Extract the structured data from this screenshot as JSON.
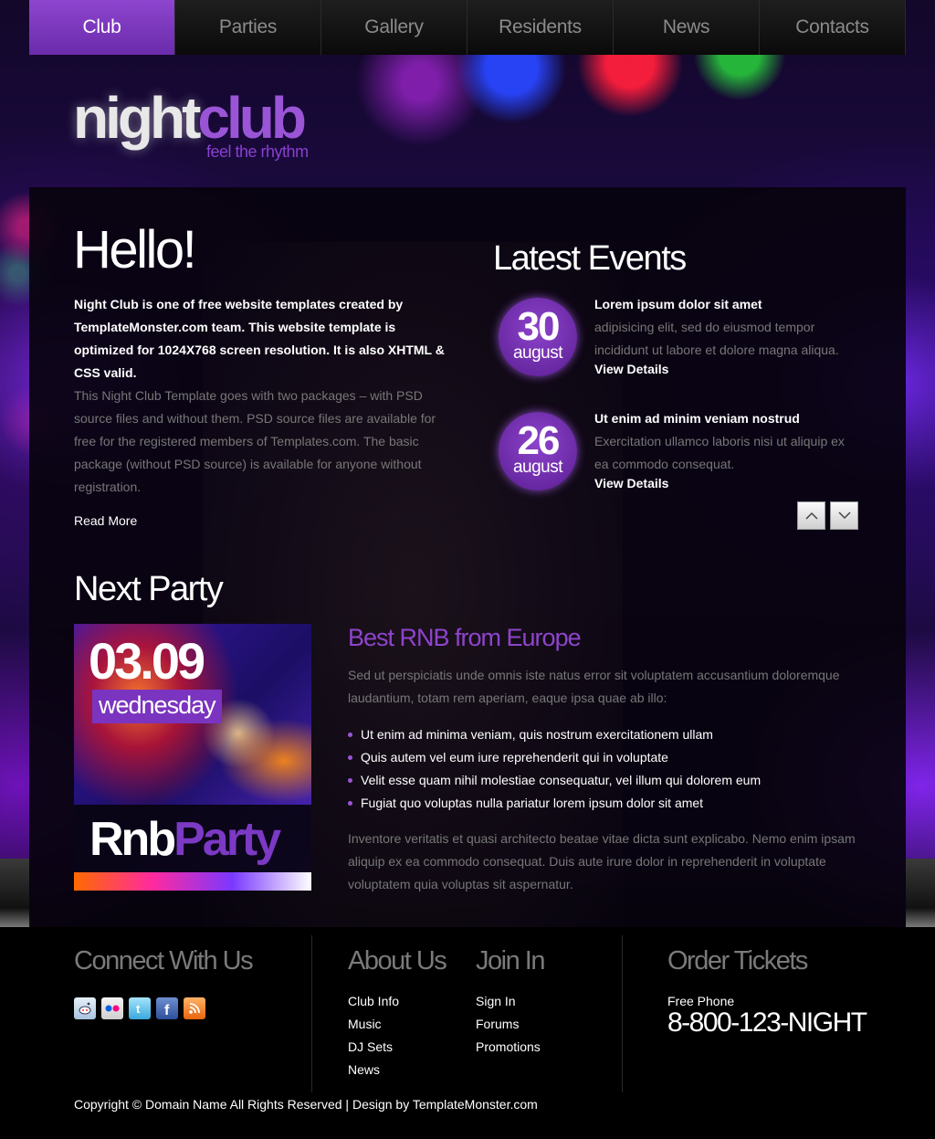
{
  "nav": {
    "items": [
      {
        "label": "Club"
      },
      {
        "label": "Parties"
      },
      {
        "label": "Gallery"
      },
      {
        "label": "Residents"
      },
      {
        "label": "News"
      },
      {
        "label": "Contacts"
      }
    ],
    "active_index": 0
  },
  "logo": {
    "night": "night",
    "club": "club",
    "tagline": "feel the rhythm"
  },
  "welcome": {
    "title": "Hello!",
    "intro_bold": "Night Club is one of free website templates created by TemplateMonster.com team. This website template is optimized for 1024X768 screen resolution. It is also XHTML & CSS valid.",
    "intro_text": "This Night Club Template goes with two packages – with PSD source files and without them. PSD source files are available for free for the registered members of Templates.com. The basic package (without PSD source) is available for anyone without registration.",
    "read_more": "Read More"
  },
  "events": {
    "title": "Latest Events",
    "items": [
      {
        "day": "30",
        "month": "august",
        "title": "Lorem ipsum dolor sit amet",
        "desc": "adipisicing elit, sed do eiusmod tempor incididunt ut labore et dolore magna aliqua.",
        "link": "View Details"
      },
      {
        "day": "26",
        "month": "august",
        "title": "Ut enim ad minim veniam nostrud",
        "desc": "Exercitation ullamco laboris nisi ut aliquip ex ea commodo consequat.",
        "link": "View Details"
      }
    ],
    "prev_icon": "chevron-up-icon",
    "next_icon": "chevron-down-icon"
  },
  "next_party": {
    "title": "Next Party",
    "poster": {
      "date": "03.09",
      "weekday": "wednesday",
      "name_a": "Rnb",
      "name_b": "Party"
    },
    "headline": "Best RNB from Europe",
    "description": "Sed ut perspiciatis unde omnis iste natus error sit voluptatem accusantium doloremque laudantium, totam rem aperiam, eaque ipsa quae ab illo:",
    "bullets": [
      "Ut enim ad minima veniam, quis nostrum exercitationem ullam",
      "Quis autem vel eum iure reprehenderit qui in voluptate",
      "Velit esse quam nihil molestiae consequatur, vel illum qui dolorem eum",
      "Fugiat quo voluptas nulla pariatur lorem ipsum dolor sit amet"
    ],
    "footer_text": "Inventore veritatis et quasi architecto beatae vitae dicta sunt explicabo. Nemo enim ipsam aliquip ex ea commodo consequat. Duis aute irure dolor in reprehenderit in voluptate voluptatem quia voluptas sit aspernatur."
  },
  "footer": {
    "connect": {
      "title": "Connect With Us",
      "icons": [
        "reddit-icon",
        "flickr-icon",
        "twitter-icon",
        "facebook-icon",
        "rss-icon"
      ]
    },
    "about": {
      "title": "About Us",
      "links": [
        "Club Info",
        "Music",
        "DJ Sets",
        "News"
      ]
    },
    "join": {
      "title": "Join In",
      "links": [
        "Sign In",
        "Forums",
        "Promotions"
      ]
    },
    "tickets": {
      "title": "Order Tickets",
      "label": "Free Phone",
      "phone": "8-800-123-NIGHT"
    },
    "copyright": "Copyright © Domain Name All Rights Reserved | Design by TemplateMonster.com"
  },
  "colors": {
    "accent": "#8e44cc",
    "nav_active": "#7b36c0",
    "text_muted": "#777777"
  }
}
